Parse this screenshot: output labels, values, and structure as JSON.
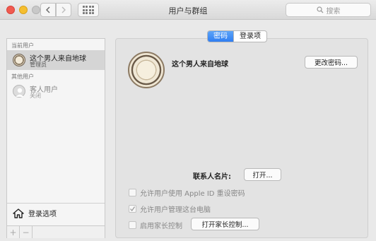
{
  "window": {
    "title": "用户与群组",
    "search_placeholder": "搜索"
  },
  "sidebar": {
    "current_users_label": "当前用户",
    "other_users_label": "其他用户",
    "current_user": {
      "name": "这个男人来自地球",
      "role": "管理员"
    },
    "guest_user": {
      "name": "客人用户",
      "status": "关闭"
    },
    "login_options_label": "登录选项",
    "add_symbol": "+",
    "remove_symbol": "−"
  },
  "tabs": [
    {
      "label": "密码",
      "active": true
    },
    {
      "label": "登录项",
      "active": false
    }
  ],
  "panel": {
    "user_name": "这个男人来自地球",
    "change_password_button": "更改密码...",
    "contact_card_label": "联系人名片:",
    "open_button": "打开...",
    "allow_apple_id_reset": {
      "label": "允许用户使用 Apple ID 重设密码",
      "checked": false
    },
    "allow_admin": {
      "label": "允许用户管理这台电脑",
      "checked": true
    },
    "parental_controls": {
      "label": "启用家长控制",
      "checked": false
    },
    "open_parental_button": "打开家长控制..."
  },
  "icons": {
    "back": "chevron-left-icon",
    "forward": "chevron-right-icon",
    "show_all": "grid-icon",
    "search": "magnifier-icon",
    "home": "house-icon"
  },
  "colors": {
    "accent": "#2f7ef2",
    "close": "#f05a4f",
    "minimize": "#f5be2f"
  }
}
